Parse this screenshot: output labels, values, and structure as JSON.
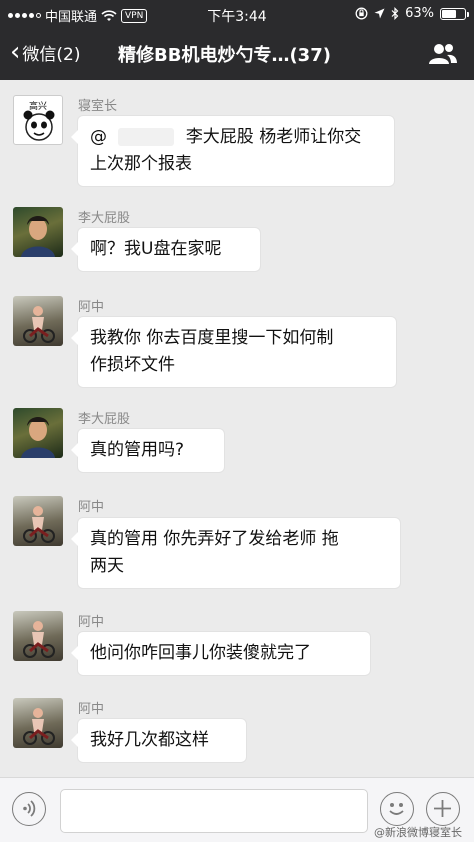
{
  "status_bar": {
    "carrier": "中国联通",
    "vpn": "VPN",
    "time": "下午3:44",
    "battery": "63%",
    "battery_level": 0.63
  },
  "nav": {
    "back_label": "微信(2)",
    "title": "精修BB机电炒勺专…(37)",
    "members_icon": "group-members-icon"
  },
  "messages": [
    {
      "sender": "寝室长",
      "avatar": "meme-avatar",
      "line1": "@",
      "line1b": "李大屁股 杨老师让你交",
      "line2": "上次那个报表",
      "avatar_text": "高兴"
    },
    {
      "sender": "李大屁股",
      "avatar": "li-photo-avatar",
      "line1": "啊？我U盘在家呢"
    },
    {
      "sender": "阿中",
      "avatar": "zhong-photo-avatar",
      "line1": "我教你 你去百度里搜一下如何制",
      "line2": "作损坏文件"
    },
    {
      "sender": "李大屁股",
      "avatar": "li-photo-avatar",
      "line1": "真的管用吗?"
    },
    {
      "sender": "阿中",
      "avatar": "zhong-photo-avatar",
      "line1": "真的管用 你先弄好了发给老师 拖",
      "line2": "两天"
    },
    {
      "sender": "阿中",
      "avatar": "zhong-photo-avatar",
      "line1": "他问你咋回事儿你装傻就完了"
    },
    {
      "sender": "阿中",
      "avatar": "zhong-photo-avatar",
      "line1": "我好几次都这样"
    }
  ],
  "input_bar": {
    "voice_icon": "voice-icon",
    "emoji_icon": "emoji-icon",
    "plus_icon": "plus-icon",
    "watermark": "@新浪微博寝室长"
  }
}
